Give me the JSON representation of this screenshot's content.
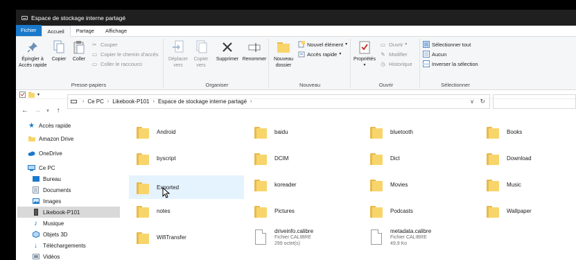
{
  "window": {
    "title": "Espace de stockage interne partagé"
  },
  "tabs": [
    {
      "label": "Fichier"
    },
    {
      "label": "Accueil"
    },
    {
      "label": "Partage"
    },
    {
      "label": "Affichage"
    }
  ],
  "ribbon": {
    "clipboard": {
      "group_label": "Presse-papiers",
      "pin": "Épingler à\nAccès rapide",
      "copy": "Copier",
      "paste": "Coller",
      "cut": "Couper",
      "copy_path": "Copier le chemin d'accès",
      "paste_shortcut": "Coller le raccourci"
    },
    "organize": {
      "group_label": "Organiser",
      "move_to": "Déplacer\nvers",
      "copy_to": "Copier\nvers",
      "delete": "Supprimer",
      "rename": "Renommer"
    },
    "new": {
      "group_label": "Nouveau",
      "new_folder": "Nouveau\ndossier",
      "new_item": "Nouvel élément",
      "easy_access": "Accès rapide"
    },
    "open": {
      "group_label": "Ouvrir",
      "properties": "Propriétés",
      "open": "Ouvrir",
      "edit": "Modifier",
      "history": "Historique"
    },
    "select": {
      "group_label": "Sélectionner",
      "select_all": "Sélectionner tout",
      "select_none": "Aucun",
      "invert": "Inverser la sélection"
    }
  },
  "address": {
    "crumbs": [
      "Ce PC",
      "Likebook-P101",
      "Espace de stockage interne partagé"
    ]
  },
  "nav": {
    "items": [
      {
        "label": "Accès rapide",
        "icon": "star-icon"
      },
      {
        "label": "Amazon Drive",
        "icon": "amazon-drive-icon"
      },
      {
        "label": "OneDrive",
        "icon": "cloud-icon"
      },
      {
        "label": "Ce PC",
        "icon": "computer-icon"
      },
      {
        "label": "Bureau",
        "icon": "desktop-icon"
      },
      {
        "label": "Documents",
        "icon": "documents-icon"
      },
      {
        "label": "Images",
        "icon": "images-icon"
      },
      {
        "label": "Likebook-P101",
        "icon": "device-icon"
      },
      {
        "label": "Musique",
        "icon": "music-icon"
      },
      {
        "label": "Objets 3D",
        "icon": "cube-icon"
      },
      {
        "label": "Téléchargements",
        "icon": "download-icon"
      },
      {
        "label": "Vidéos",
        "icon": "video-icon"
      }
    ]
  },
  "files": [
    {
      "name": "Android",
      "type": "folder"
    },
    {
      "name": "baidu",
      "type": "folder"
    },
    {
      "name": "bluetooth",
      "type": "folder"
    },
    {
      "name": "Books",
      "type": "folder"
    },
    {
      "name": "byscript",
      "type": "folder"
    },
    {
      "name": "DCIM",
      "type": "folder"
    },
    {
      "name": "Dict",
      "type": "folder"
    },
    {
      "name": "Download",
      "type": "folder"
    },
    {
      "name": "Exported",
      "type": "folder"
    },
    {
      "name": "koreader",
      "type": "folder"
    },
    {
      "name": "Movies",
      "type": "folder"
    },
    {
      "name": "Music",
      "type": "folder"
    },
    {
      "name": "notes",
      "type": "folder"
    },
    {
      "name": "Pictures",
      "type": "folder"
    },
    {
      "name": "Podcasts",
      "type": "folder"
    },
    {
      "name": "Wallpaper",
      "type": "folder"
    },
    {
      "name": "WifiTransfer",
      "type": "folder"
    },
    {
      "name": "driveinfo.calibre",
      "type": "file",
      "kind": "Fichier CALIBRE",
      "size": "299 octet(s)"
    },
    {
      "name": "metadata.calibre",
      "type": "file",
      "kind": "Fichier CALIBRE",
      "size": "49,9 Ko"
    }
  ]
}
